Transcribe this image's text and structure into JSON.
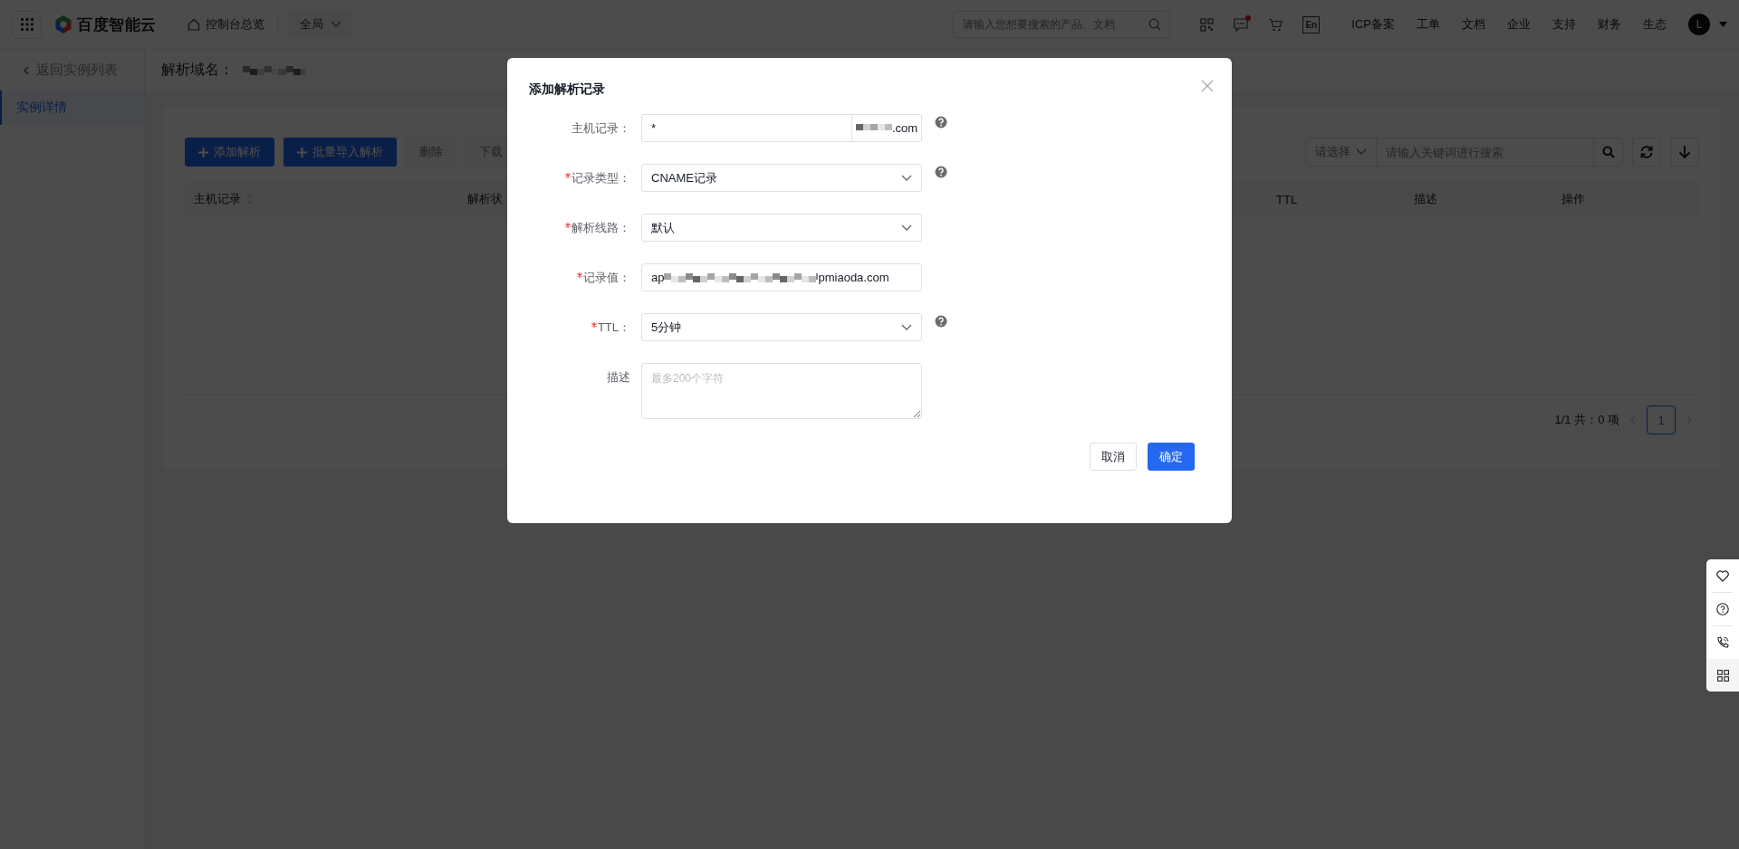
{
  "top_bar": {
    "brand": "百度智能云",
    "home_link": "控制台总览",
    "scope": "全局",
    "search": {
      "placeholder": "请输入您想要搜索的产品、文档"
    },
    "lang_badge": "En",
    "message_unread": true,
    "nav": [
      "ICP备案",
      "工单",
      "文档",
      "企业",
      "支持",
      "财务",
      "生态"
    ],
    "avatar": "L"
  },
  "sidebar": {
    "back": "返回实例列表",
    "items": [
      {
        "label": "实例详情",
        "selected": true
      }
    ]
  },
  "page_header": {
    "label": "解析域名："
  },
  "toolbar": {
    "buttons": [
      {
        "label": "添加解析",
        "kind": "primary"
      },
      {
        "label": "批量导入解析",
        "kind": "primary"
      },
      {
        "label": "删除",
        "kind": "disabled"
      },
      {
        "label": "下载",
        "kind": "disabled"
      }
    ],
    "filter": {
      "select_placeholder": "请选择",
      "search_placeholder": "请输入关键词进行搜索"
    }
  },
  "table": {
    "columns": [
      {
        "label": "主机记录",
        "sortable": true
      },
      {
        "label": "解析状",
        "sortable": false
      },
      {
        "label": "TTL",
        "sortable": false
      },
      {
        "label": "描述",
        "sortable": false
      },
      {
        "label": "操作",
        "sortable": false
      }
    ]
  },
  "pagination": {
    "summary": "1/1 共：0 项",
    "pages": [
      {
        "label": "1",
        "selected": true
      }
    ]
  },
  "dialog": {
    "title": "添加解析记录",
    "fields": [
      {
        "label": "主机记录：",
        "required": false,
        "kind": "suffix",
        "value": "*",
        "suffix": ".com",
        "help": true
      },
      {
        "label": "记录类型：",
        "required": true,
        "kind": "select",
        "value": "CNAME记录",
        "help": true
      },
      {
        "label": "解析线路：",
        "required": true,
        "kind": "select",
        "value": "默认",
        "help": false
      },
      {
        "label": "记录值：",
        "required": true,
        "kind": "redacted",
        "value_start": "ap",
        "value_end": "pmiaoda.com",
        "help": false
      },
      {
        "label": "TTL：",
        "required": true,
        "kind": "select",
        "value": "5分钟",
        "help": true
      },
      {
        "label": "描述",
        "required": false,
        "kind": "textarea",
        "placeholder": "最多200个字符",
        "help": false
      }
    ],
    "buttons": [
      {
        "label": "取消",
        "kind": "secondary"
      },
      {
        "label": "确定",
        "kind": "primary"
      }
    ]
  }
}
